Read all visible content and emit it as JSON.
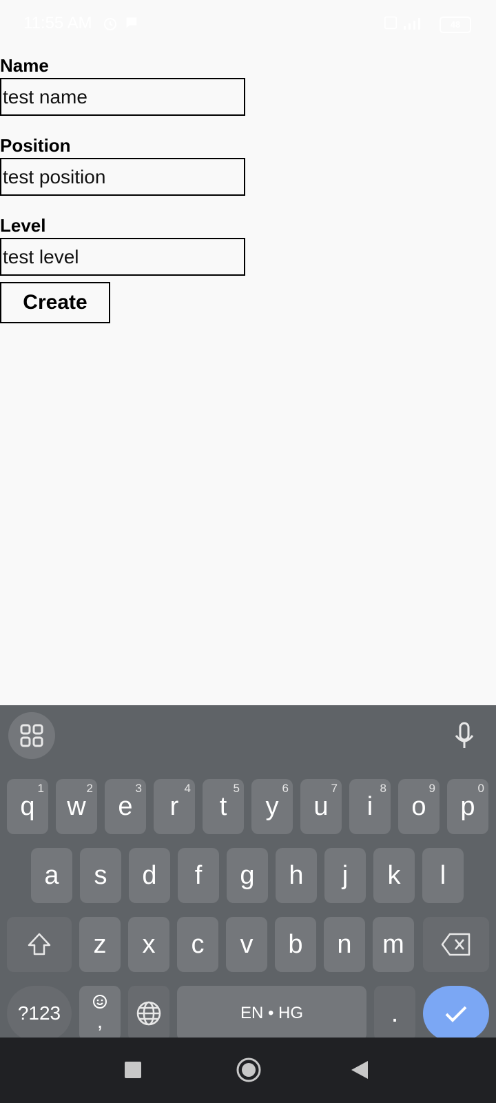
{
  "status_bar": {
    "time": "11:55 AM",
    "battery": "48",
    "icons": [
      "alarm-icon",
      "chat-bubble-icon",
      "sim-icon",
      "signal-icon",
      "battery-icon"
    ]
  },
  "form": {
    "name_label": "Name",
    "name_value": "test name",
    "position_label": "Position",
    "position_value": "test position",
    "level_label": "Level",
    "level_value": "test level",
    "create_label": "Create"
  },
  "keyboard": {
    "row1": [
      {
        "k": "q",
        "n": "1"
      },
      {
        "k": "w",
        "n": "2"
      },
      {
        "k": "e",
        "n": "3"
      },
      {
        "k": "r",
        "n": "4"
      },
      {
        "k": "t",
        "n": "5"
      },
      {
        "k": "y",
        "n": "6"
      },
      {
        "k": "u",
        "n": "7"
      },
      {
        "k": "i",
        "n": "8"
      },
      {
        "k": "o",
        "n": "9"
      },
      {
        "k": "p",
        "n": "0"
      }
    ],
    "row2": [
      "a",
      "s",
      "d",
      "f",
      "g",
      "h",
      "j",
      "k",
      "l"
    ],
    "row3": [
      "z",
      "x",
      "c",
      "v",
      "b",
      "n",
      "m"
    ],
    "symbols_label": "?123",
    "emoji_comma": ",",
    "space_label": "EN • HG",
    "period": ".",
    "colors": {
      "background": "#5f6367",
      "key": "#74777b",
      "enter": "#7ba7f4"
    }
  }
}
